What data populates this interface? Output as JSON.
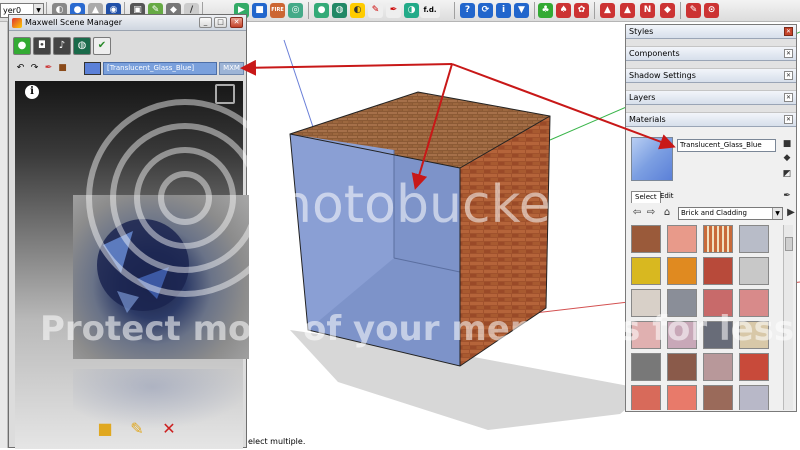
{
  "toolbar": {
    "layer_dropdown": "yer0",
    "fd_label": "f.d.",
    "fire_label": "FIRE"
  },
  "maxwell": {
    "title": "Maxwell Scene Manager",
    "material_name": "[Translucent_Glass_Blue]",
    "mxm_label": "MXM",
    "info_symbol": "i",
    "accent_swatch": "#5b80d8"
  },
  "materials_dock": {
    "panels": [
      "Styles",
      "Components",
      "Shadow Settings",
      "Layers",
      "Materials"
    ],
    "material_name": "Translucent_Glass_Blue",
    "tabs": [
      "Select",
      "Edit"
    ],
    "collection": "Brick and Cladding"
  },
  "status": {
    "text": "elect multiple."
  },
  "watermark": {
    "brand": "photobucket",
    "tagline": "Protect more of your memories for less!"
  }
}
